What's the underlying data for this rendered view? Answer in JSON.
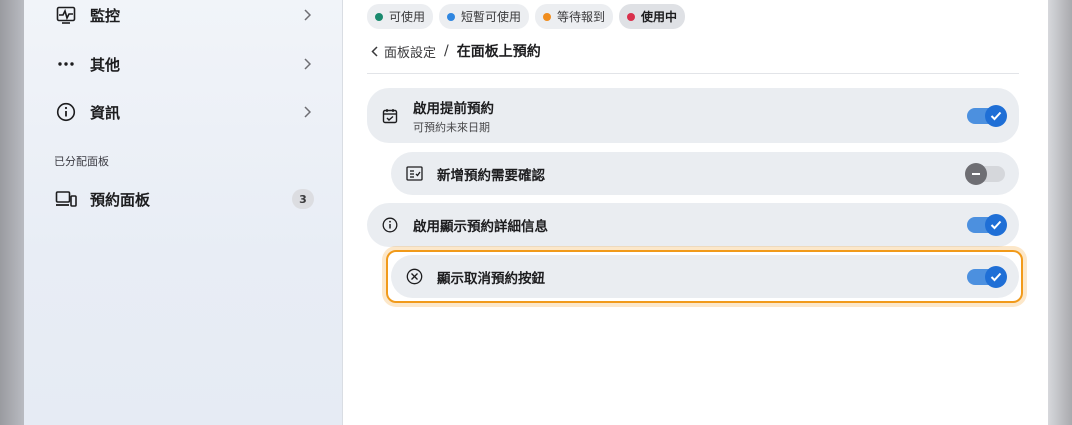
{
  "sidebar": {
    "items": [
      {
        "label": "監控",
        "icon": "monitor-chart-icon"
      },
      {
        "label": "其他",
        "icon": "more-dots-icon"
      },
      {
        "label": "資訊",
        "icon": "info-icon"
      }
    ],
    "section_title": "已分配面板",
    "panels": [
      {
        "label": "預約面板",
        "icon": "devices-icon",
        "count": "3"
      }
    ]
  },
  "legend": [
    {
      "label": "可使用",
      "color": "#1a8a6e"
    },
    {
      "label": "短暫可使用",
      "color": "#2f86e0"
    },
    {
      "label": "等待報到",
      "color": "#f08d1e"
    },
    {
      "label": "使用中",
      "color": "#d9304c"
    }
  ],
  "breadcrumb": {
    "back_label": "面板設定",
    "separator": "/",
    "current": "在面板上預約"
  },
  "settings": [
    {
      "title": "啟用提前預約",
      "subtitle": "可預約未來日期",
      "icon": "calendar-check-icon",
      "enabled": true
    },
    {
      "title": "新增預約需要確認",
      "icon": "checklist-icon",
      "enabled": false
    },
    {
      "title": "啟用顯示預約詳細信息",
      "icon": "info-icon",
      "enabled": true
    },
    {
      "title": "顯示取消預約按鈕",
      "icon": "cancel-circle-icon",
      "enabled": true,
      "focused": true
    }
  ],
  "colors": {
    "toggle_on": "#1f6fd6",
    "toggle_off": "#6e6e73",
    "focus": "#f19a1a"
  }
}
